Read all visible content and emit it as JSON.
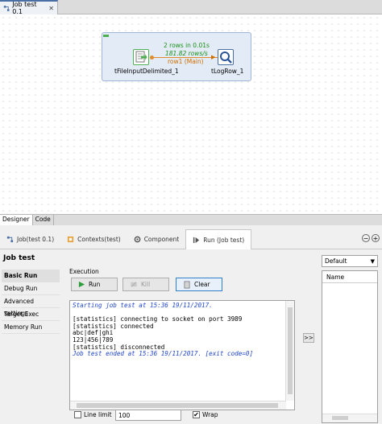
{
  "editor_tab": {
    "title": "Job test 0.1",
    "close": "✕"
  },
  "canvas": {
    "component1": {
      "name": "tFileInputDelimited_1"
    },
    "component2": {
      "name": "tLogRow_1"
    },
    "connection": {
      "stats_rows": "2 rows in 0.01s",
      "stats_rate": "181.82 rows/s",
      "label": "row1 (Main)"
    }
  },
  "designer_tabs": [
    "Designer",
    "Code"
  ],
  "view_tabs": [
    {
      "label": "Job(test 0.1)",
      "icon": "job-icon"
    },
    {
      "label": "Contexts(test)",
      "icon": "contexts-icon"
    },
    {
      "label": "Component",
      "icon": "component-icon"
    },
    {
      "label": "Run (Job test)",
      "icon": "run-icon"
    }
  ],
  "view_title": "Job test",
  "side_nav": [
    "Basic Run",
    "Debug Run",
    "Advanced settings",
    "Target Exec",
    "Memory Run"
  ],
  "execution": {
    "group_label": "Execution",
    "run_label": "Run",
    "kill_label": "Kill",
    "clear_label": "Clear"
  },
  "console_lines": [
    {
      "text": "Starting job test at 15:36 19/11/2017.",
      "style": "blue"
    },
    {
      "text": "",
      "style": ""
    },
    {
      "text": "[statistics] connecting to socket on port 3989",
      "style": ""
    },
    {
      "text": "[statistics] connected",
      "style": ""
    },
    {
      "text": "abc|def|ghi",
      "style": ""
    },
    {
      "text": "123|456|789",
      "style": ""
    },
    {
      "text": "[statistics] disconnected",
      "style": ""
    },
    {
      "text": "Job test ended at 15:36 19/11/2017. [exit code=0]",
      "style": "blue"
    }
  ],
  "move_right_label": ">>",
  "context": {
    "selected": "Default",
    "column_header": "Name"
  },
  "bottom": {
    "line_limit_label": "Line limit",
    "line_limit_value": "100",
    "line_limit_checked": false,
    "wrap_label": "Wrap",
    "wrap_checked": true,
    "wrap_check": "✔"
  },
  "colors": {
    "accent": "#2f7fc9",
    "console_blue": "#1f46c8",
    "run_green": "#2e9e3b",
    "connection": "#e28b2c"
  }
}
